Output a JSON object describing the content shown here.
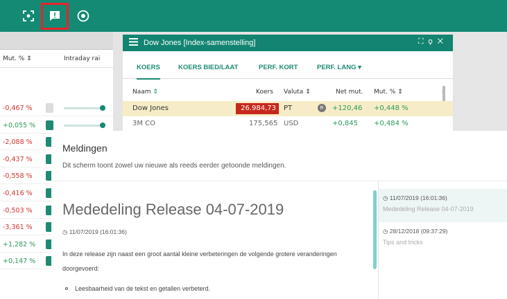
{
  "topbar": {
    "icons": [
      "focus-icon",
      "message-icon",
      "record-icon"
    ],
    "highlight_color": "#e8232b",
    "bg_color": "#148a74"
  },
  "left_panel": {
    "dropdown": "-",
    "col_mut": "Mut. %",
    "col_intraday": "Intraday rai",
    "rows": [
      {
        "mut": "-0,467 %",
        "color": "#d0342c"
      },
      {
        "mut": "+0,055 %",
        "color": "#2d9a5a"
      },
      {
        "mut": "-2,088 %",
        "color": "#d0342c"
      },
      {
        "mut": "-0,437 %",
        "color": "#d0342c"
      },
      {
        "mut": "-0,558 %",
        "color": "#d0342c"
      },
      {
        "mut": "-0,416 %",
        "color": "#d0342c"
      },
      {
        "mut": "-0,503 %",
        "color": "#d0342c"
      },
      {
        "mut": "-3,361 %",
        "color": "#d0342c"
      },
      {
        "mut": "+1,282 %",
        "color": "#2d9a5a"
      },
      {
        "mut": "+0,147 %",
        "color": "#2d9a5a"
      }
    ]
  },
  "dj_window": {
    "title": "Dow Jones [Index-samenstelling]",
    "controls": "⛶ ⚲ ✕",
    "tabs": [
      "KOERS",
      "KOERS BIED/LAAT",
      "PERF. KORT",
      "PERF. LANG ▾"
    ],
    "columns": {
      "naam": "Naam",
      "koers": "Koers",
      "valuta": "Valuta",
      "net_mut": "Net mut.",
      "mut_pct": "Mut. %",
      "extra": "I"
    },
    "row1": {
      "naam": "Dow Jones",
      "koers": "26.984,73",
      "valuta": "PT",
      "badge": "R",
      "net_mut": "+120,46",
      "mut_pct": "+0,448 %"
    },
    "row2": {
      "naam": "3M CO",
      "koers": "175,565",
      "valuta": "USD",
      "net_mut": "+0,845",
      "mut_pct": "+0,484 %"
    }
  },
  "modal": {
    "title": "Meldingen",
    "subtitle": "Dit scherm toont zowel uw nieuwe als reeds eerder getoonde meldingen.",
    "article": {
      "title": "Mededeling Release 04-07-2019",
      "date": "11/07/2019 (16:01:36)",
      "body": "In deze release zijn naast een groot aantal kleine verbeteringen de volgende grotere veranderingen doorgevoerd:",
      "bullets": [
        "Leesbaarheid van de tekst en getallen verbeterd."
      ]
    },
    "list": [
      {
        "date": "11/07/2019 (16:01:36)",
        "title": "Mededeling Release 04-07-2019",
        "selected": true
      },
      {
        "date": "28/12/2018 (09:37:29)",
        "title": "Tips and tricks",
        "selected": false
      }
    ]
  }
}
